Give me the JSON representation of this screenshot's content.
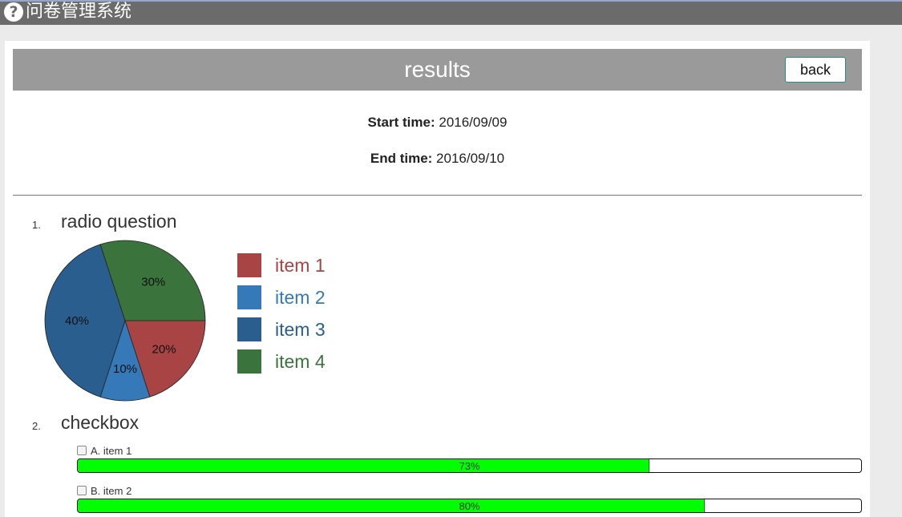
{
  "app": {
    "title": "问卷管理系统",
    "logo_icon": "question-circle-icon"
  },
  "page": {
    "title": "results",
    "back_label": "back"
  },
  "times": {
    "start_label": "Start time:",
    "start_value": "2016/09/09",
    "end_label": "End time:",
    "end_value": "2016/09/10"
  },
  "questions": [
    {
      "number": "1.",
      "title": "radio question"
    },
    {
      "number": "2.",
      "title": "checkbox"
    }
  ],
  "chart_data": {
    "type": "pie",
    "slices": [
      {
        "name": "item 1",
        "value": 20,
        "label": "20%",
        "color": "#a84444"
      },
      {
        "name": "item 2",
        "value": 10,
        "label": "10%",
        "color": "#3579b8"
      },
      {
        "name": "item 3",
        "value": 40,
        "label": "40%",
        "color": "#2a5e8e"
      },
      {
        "name": "item 4",
        "value": 30,
        "label": "30%",
        "color": "#3b733c"
      }
    ],
    "legend_position": "right"
  },
  "checkbox_results": [
    {
      "label": "A. item 1",
      "percent": 73,
      "percent_text": "73%"
    },
    {
      "label": "B. item 2",
      "percent": 80,
      "percent_text": "80%"
    }
  ],
  "colors": {
    "bar_fill": "#00ff00",
    "topbar": "#6b6b6b",
    "header": "#9a9a9a"
  }
}
